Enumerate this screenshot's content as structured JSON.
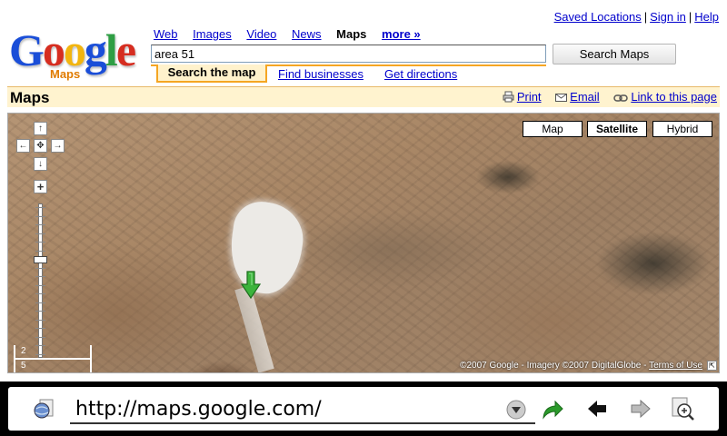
{
  "top_links": {
    "saved": "Saved Locations",
    "signin": "Sign in",
    "help": "Help",
    "sep": "|"
  },
  "logo": {
    "letters": [
      "G",
      "o",
      "o",
      "g",
      "l",
      "e"
    ],
    "colors": [
      "#1a4ed8",
      "#d62d20",
      "#f2b50f",
      "#1a4ed8",
      "#2f9e44",
      "#d62d20"
    ],
    "sub": "Maps"
  },
  "nav": {
    "web": "Web",
    "images": "Images",
    "video": "Video",
    "news": "News",
    "maps": "Maps",
    "more": "more »"
  },
  "search": {
    "value": "area 51",
    "button": "Search Maps"
  },
  "subtabs": {
    "search_map": "Search the map",
    "find": "Find businesses",
    "directions": "Get directions"
  },
  "bar": {
    "title": "Maps",
    "print": "Print",
    "email": "Email",
    "link": "Link to this page"
  },
  "map": {
    "types": {
      "map": "Map",
      "satellite": "Satellite",
      "hybrid": "Hybrid"
    },
    "pan": {
      "up": "↑",
      "left": "←",
      "center": "✥",
      "right": "→",
      "down": "↓"
    },
    "zoom_in": "+",
    "zoom_level": 0.36,
    "scale": {
      "miles": "2",
      "km": "5"
    },
    "copyright": "©2007 Google - Imagery ©2007 DigitalGlobe -",
    "terms": "Terms of Use",
    "resize_glyph": "⇱"
  },
  "browser": {
    "url": "http://maps.google.com/",
    "accent": "#2a9a2a"
  }
}
